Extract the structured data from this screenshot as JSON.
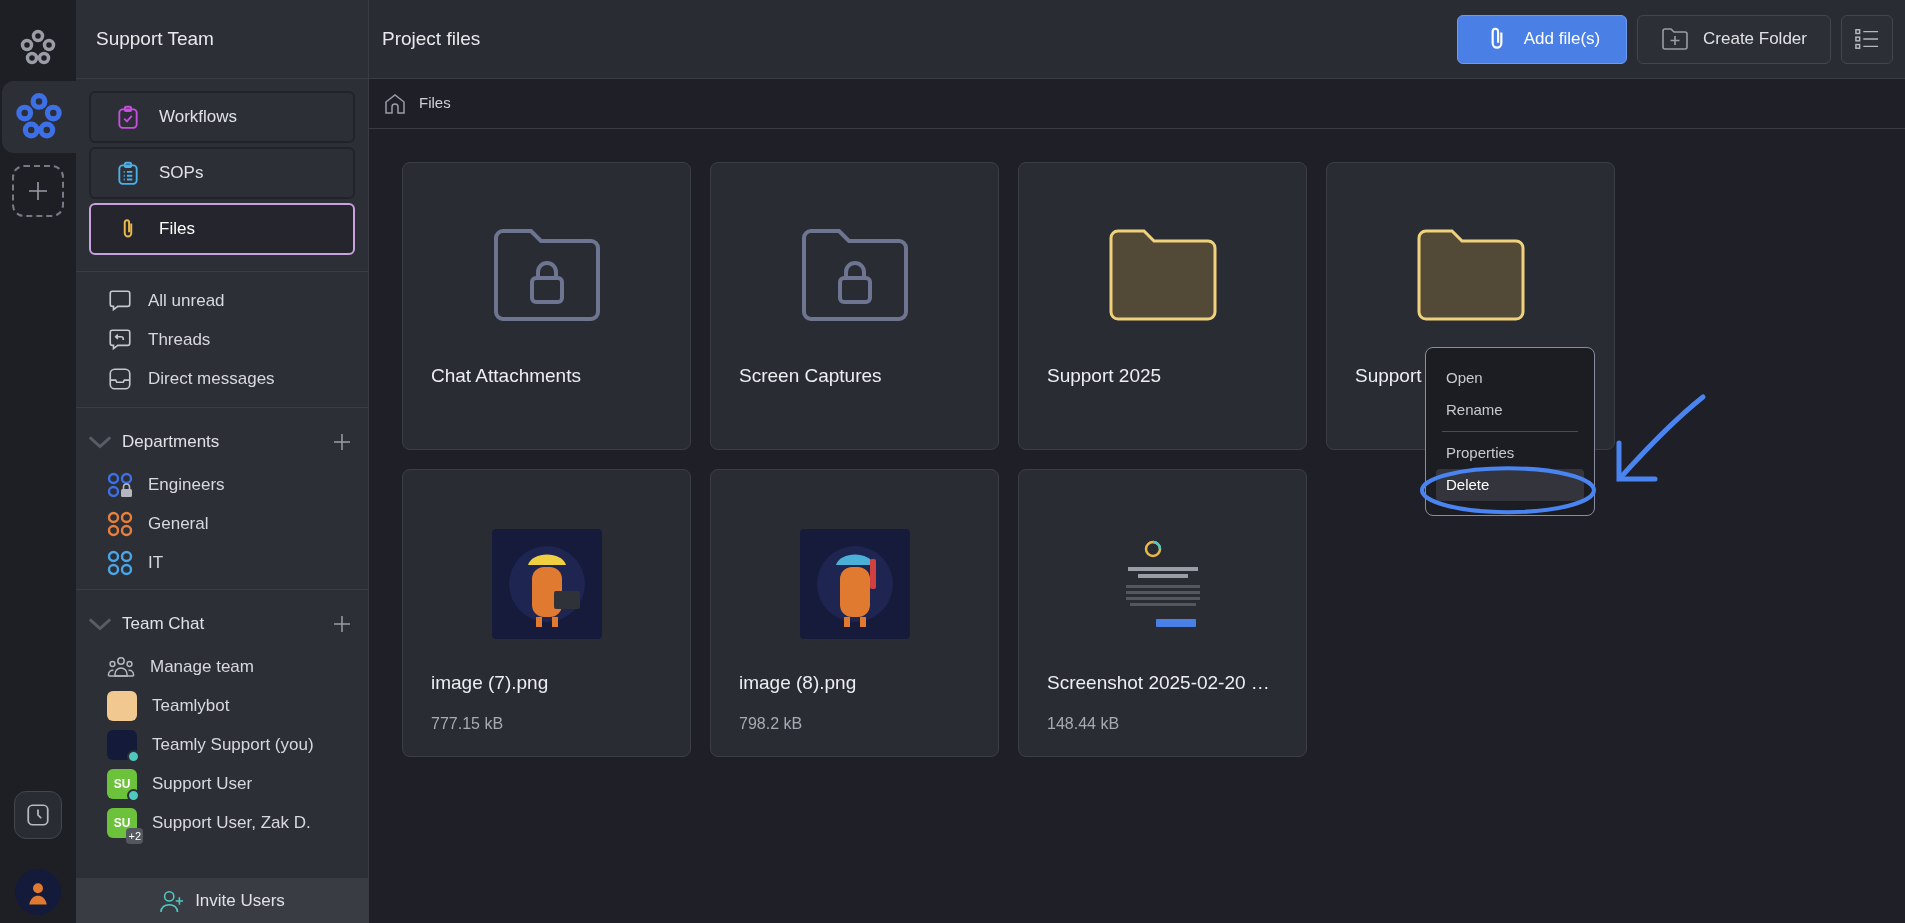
{
  "rail": {
    "workspaces": [
      {
        "selected": false
      },
      {
        "selected": true
      }
    ]
  },
  "sidebar": {
    "title": "Support Team",
    "tools": [
      {
        "label": "Workflows",
        "kind": "workflows",
        "selected": false
      },
      {
        "label": "SOPs",
        "kind": "sops",
        "selected": false
      },
      {
        "label": "Files",
        "kind": "files",
        "selected": true
      }
    ],
    "views": [
      {
        "label": "All unread",
        "kind": "unread"
      },
      {
        "label": "Threads",
        "kind": "threads"
      },
      {
        "label": "Direct messages",
        "kind": "direct"
      }
    ],
    "sections": [
      {
        "title": "Departments",
        "expanded": true,
        "items": [
          {
            "label": "Engineers",
            "kind": "channel",
            "color": "#3d6fe6",
            "locked": true
          },
          {
            "label": "General",
            "kind": "channel",
            "color": "#e8803c",
            "locked": false
          },
          {
            "label": "IT",
            "kind": "channel",
            "color": "#4aa6e8",
            "locked": false
          }
        ]
      },
      {
        "title": "Team Chat",
        "expanded": true,
        "items": [
          {
            "label": "Manage team",
            "kind": "manage"
          },
          {
            "label": "Teamlybot",
            "kind": "avatar",
            "online": false
          },
          {
            "label": "Teamly Support (you)",
            "kind": "avatar",
            "online": true
          },
          {
            "label": "Support User",
            "kind": "initials",
            "initials": "SU",
            "online": true
          },
          {
            "label": "Support User, Zak D.",
            "kind": "initials",
            "initials": "SU",
            "extra": "+2",
            "online": false
          }
        ]
      }
    ],
    "invite": "Invite Users"
  },
  "main": {
    "title": "Project files",
    "actions": [
      {
        "label": "Add file(s)",
        "kind": "primary"
      },
      {
        "label": "Create Folder",
        "kind": "folder"
      }
    ],
    "breadcrumb": [
      "Files"
    ],
    "items": [
      {
        "name": "Chat Attachments",
        "kind": "locked_folder"
      },
      {
        "name": "Screen Captures",
        "kind": "locked_folder"
      },
      {
        "name": "Support 2025",
        "kind": "folder"
      },
      {
        "name": "Support",
        "kind": "folder"
      },
      {
        "name": "image (7).png",
        "size": "777.15 kB"
      },
      {
        "name": "image (8).png",
        "size": "798.2 kB"
      },
      {
        "name": "Screenshot 2025-02-20 …",
        "kind": "screenshot",
        "size": "148.44 kB"
      }
    ],
    "context_menu": [
      {
        "label": "Open",
        "selected": false,
        "divider_after": false
      },
      {
        "label": "Rename",
        "selected": false,
        "divider_after": true
      },
      {
        "label": "Properties",
        "selected": false,
        "divider_after": false
      },
      {
        "label": "Delete",
        "selected": true,
        "divider_after": false
      }
    ]
  }
}
